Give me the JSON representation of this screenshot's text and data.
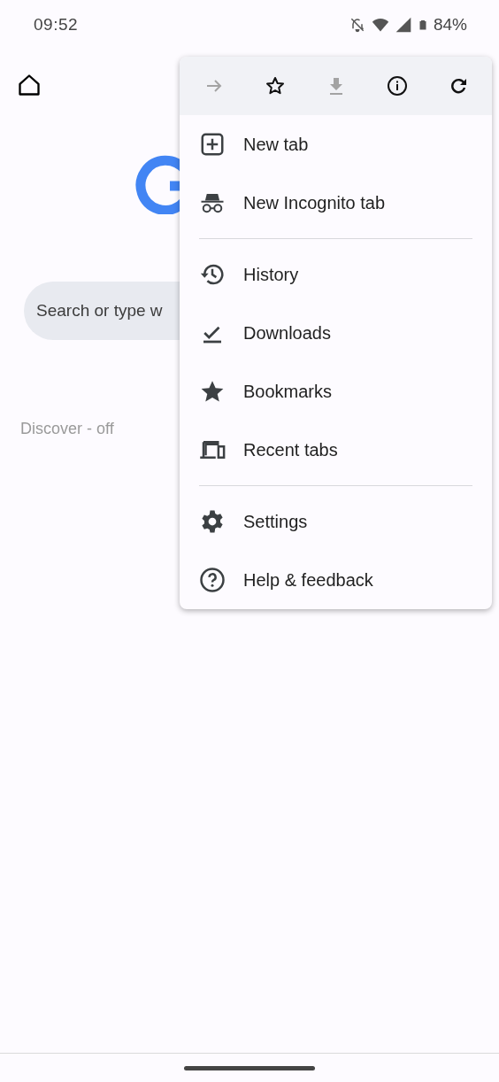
{
  "status_bar": {
    "time": "09:52",
    "battery": "84%"
  },
  "page": {
    "search": {
      "placeholder": "Search or type w"
    },
    "discover": "Discover - off"
  },
  "menu": {
    "toolbar": [
      {
        "kind": "forward",
        "disabled": true
      },
      {
        "kind": "bookmark",
        "disabled": false
      },
      {
        "kind": "download",
        "disabled": true
      },
      {
        "kind": "info",
        "disabled": false
      },
      {
        "kind": "reload",
        "disabled": false
      }
    ],
    "sections": [
      [
        {
          "kind": "new-tab",
          "label": "New tab"
        },
        {
          "kind": "incognito",
          "label": "New Incognito tab"
        }
      ],
      [
        {
          "kind": "history",
          "label": "History"
        },
        {
          "kind": "downloads",
          "label": "Downloads"
        },
        {
          "kind": "bookmarks",
          "label": "Bookmarks"
        },
        {
          "kind": "recent",
          "label": "Recent tabs"
        }
      ],
      [
        {
          "kind": "settings",
          "label": "Settings"
        },
        {
          "kind": "help",
          "label": "Help & feedback"
        }
      ]
    ]
  }
}
